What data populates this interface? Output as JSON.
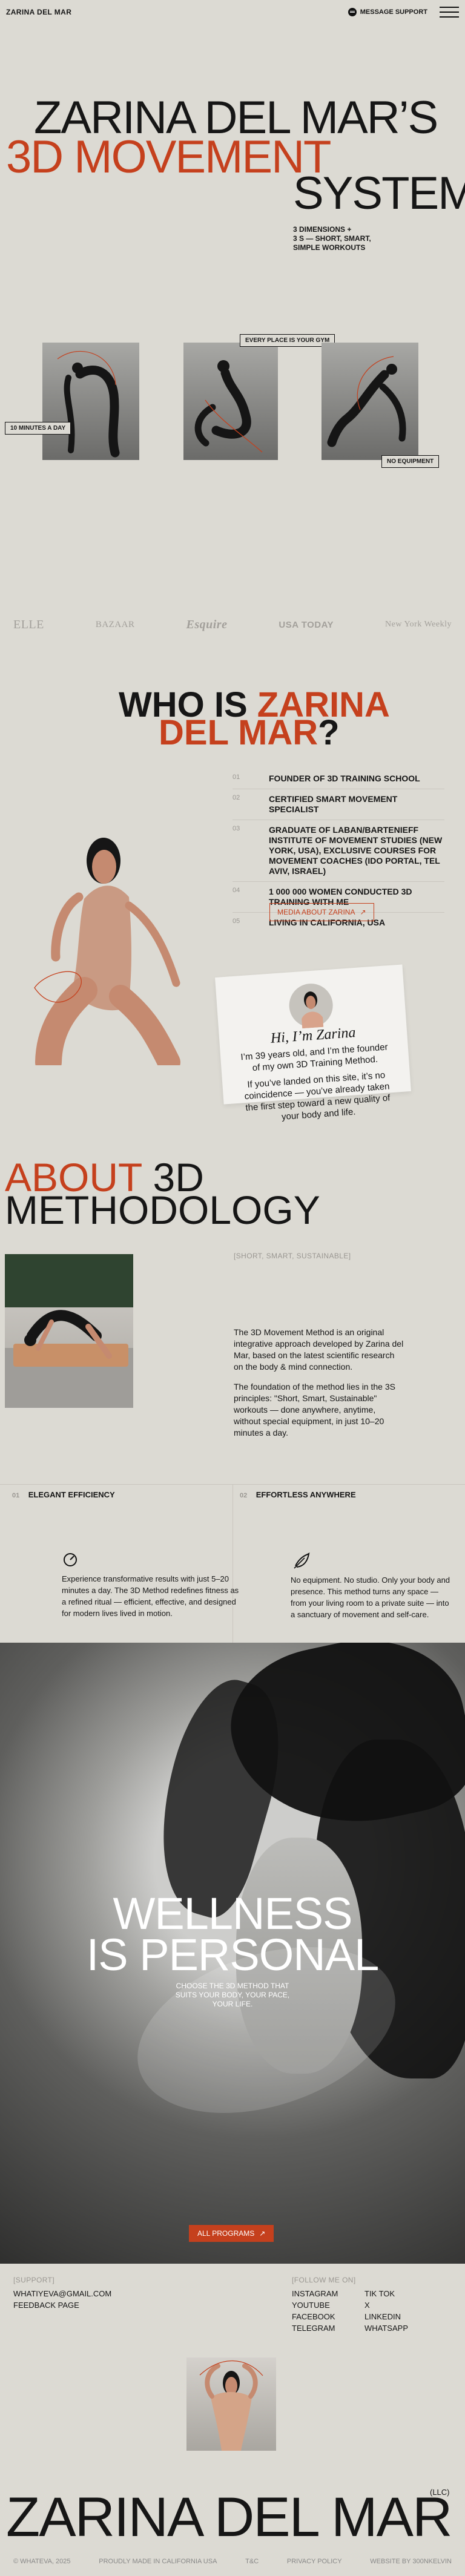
{
  "header": {
    "logo": "ZARINA DEL MAR",
    "support": "MESSAGE SUPPORT"
  },
  "hero": {
    "line1": "ZARINA DEL MAR’S",
    "line2": "3D MOVEMENT",
    "line3": "SYSTEM",
    "copy": [
      "3 DIMENSIONS +",
      "3 S — SHORT, SMART,",
      "SIMPLE WORKOUTS"
    ],
    "tag_gym": "EVERY PLACE IS YOUR GYM",
    "tag_time": "10 MINUTES A DAY",
    "tag_equipment": "NO EQUIPMENT"
  },
  "brands": [
    "ELLE",
    "BAZAAR",
    "Esquire",
    "USA TODAY",
    "New York Weekly"
  ],
  "who": {
    "title1": "WHO IS",
    "title2": "ZARINA",
    "title3": "DEL MAR",
    "question": "?",
    "facts": [
      {
        "num": "01",
        "text": "FOUNDER OF 3D TRAINING SCHOOL"
      },
      {
        "num": "02",
        "text": "CERTIFIED SMART MOVEMENT SPECIALIST"
      },
      {
        "num": "03",
        "text": "GRADUATE OF LABAN/BARTENIEFF INSTITUTE OF MOVEMENT STUDIES (NEW YORK, USA), EXCLUSIVE COURSES FOR MOVEMENT COACHES (IDO PORTAL, TEL AVIV, ISRAEL)"
      },
      {
        "num": "04",
        "text": "1 000 000 WOMEN CONDUCTED 3D TRAINING WITH ME"
      },
      {
        "num": "05",
        "text": "LIVING IN CALIFORNIA, USA"
      }
    ],
    "media_button": "MEDIA ABOUT ZARINA",
    "card_greeting": "Hi, I’m Zarina",
    "card_text1": "I’m 39 years old, and I’m the founder of my own 3D Training Method.",
    "card_text2": "If you’ve landed on this site, it’s no coincidence — you’ve already taken the first step toward a new quality of your body and life."
  },
  "method": {
    "title1": "ABOUT",
    "title2": "3D",
    "title3": "METHODOLOGY",
    "label": "[SHORT, SMART, SUSTAINABLE]",
    "p1": "The 3D Movement Method is an original integrative approach developed by Zarina del Mar, based on the latest scientific research on the body & mind connection.",
    "p2": "The foundation of the method lies in the 3S principles: \"Short, Smart, Sustainable\" workouts — done anywhere, anytime, without special equipment, in just 10–20 minutes a day.",
    "features": [
      {
        "num": "01",
        "title": "ELEGANT EFFICIENCY",
        "text": "Experience transformative results with just 5–20 minutes a day. The 3D Method redefines fitness as a refined ritual — efficient, effective, and designed for modern lives lived in motion."
      },
      {
        "num": "02",
        "title": "EFFORTLESS ANYWHERE",
        "text": "No equipment. No studio. Only your body and presence. This method turns any space — from your living room to a private suite — into a sanctuary of movement and self-care."
      }
    ]
  },
  "wellness": {
    "line1": "WELLNESS",
    "line2": "IS",
    "line3": "PERSONAL",
    "copy": "CHOOSE THE 3D METHOD THAT SUITS YOUR BODY, YOUR PACE, YOUR LIFE.",
    "button": "ALL PROGRAMS"
  },
  "footer": {
    "support_label": "[SUPPORT]",
    "follow_label": "[FOLLOW ME ON]",
    "email": "WHATIYEVA@GMAIL.COM",
    "feedback": "FEEDBACK PAGE",
    "socials_left": [
      "INSTAGRAM",
      "YOUTUBE",
      "FACEBOOK",
      "TELEGRAM"
    ],
    "socials_right": [
      "TIK TOK",
      "X",
      "LINKEDIN",
      "WHATSAPP"
    ],
    "big_name": "ZARINA DEL MAR",
    "llc": "(LLC)",
    "copyright": "© WHATEVA, 2025",
    "made": "PROUDLY MADE IN CALIFORNIA USA",
    "terms": "T&C",
    "privacy": "PRIVACY POLICY",
    "website": "WEBSITE BY 300NKELVIN"
  },
  "colors": {
    "accent": "#c5401d",
    "background": "#dcdad3",
    "text": "#161616"
  }
}
